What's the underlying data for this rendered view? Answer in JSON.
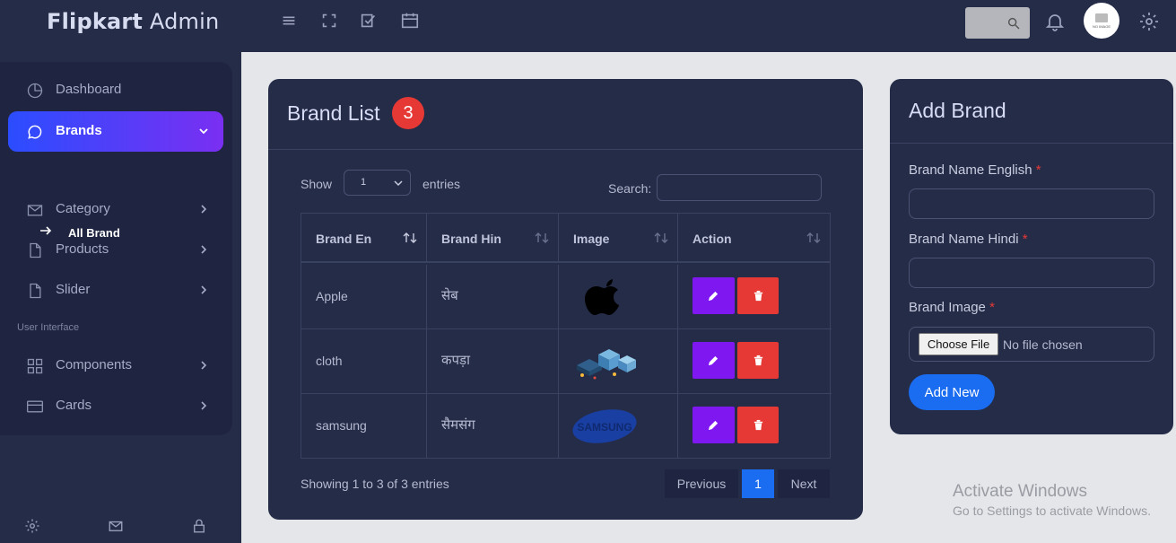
{
  "app": {
    "brand_bold": "Flipkart",
    "brand_rest": " Admin"
  },
  "topbar": {
    "icons": [
      "menu-icon",
      "fullscreen-icon",
      "checklist-icon",
      "calendar-icon"
    ],
    "avatar_text": "NO IMAGE"
  },
  "sidebar": {
    "items": [
      {
        "label": "Dashboard",
        "icon": "pie-chart-icon"
      },
      {
        "label": "Brands",
        "icon": "chat-bubble-icon",
        "active": true
      },
      {
        "label": "Category",
        "icon": "mail-icon"
      },
      {
        "label": "Products",
        "icon": "file-icon"
      },
      {
        "label": "Slider",
        "icon": "file-icon"
      },
      {
        "label": "Components",
        "icon": "grid-icon"
      },
      {
        "label": "Cards",
        "icon": "card-icon"
      }
    ],
    "sub_item": "All Brand",
    "section_title": "User Interface",
    "bottom_icons": [
      "gear-icon",
      "mail-icon",
      "lock-icon"
    ]
  },
  "brand_list": {
    "title": "Brand List",
    "count": "3",
    "show_label": "Show",
    "show_value": "1",
    "entries_label": "entries",
    "search_label": "Search:",
    "columns": [
      "Brand En",
      "Brand Hin",
      "Image",
      "Action"
    ],
    "rows": [
      {
        "en": "Apple",
        "hin": "सेब",
        "image": "apple-logo"
      },
      {
        "en": "cloth",
        "hin": "कपड़ा",
        "image": "isometric-servers"
      },
      {
        "en": "samsung",
        "hin": "सैमसंग",
        "image": "samsung-logo"
      }
    ],
    "samsung_logo_text": "SAMSUNG",
    "showing_text": "Showing 1 to 3 of 3 entries",
    "pagination": {
      "previous": "Previous",
      "page": "1",
      "next": "Next"
    }
  },
  "add_brand": {
    "title": "Add Brand",
    "label_en": "Brand Name English",
    "label_hin": "Brand Name Hindi",
    "label_image": "Brand Image",
    "required_mark": "*",
    "choose_file": "Choose File",
    "no_file": "No file chosen",
    "submit": "Add New"
  },
  "watermark": {
    "line1": "Activate Windows",
    "line2": "Go to Settings to activate Windows."
  },
  "colors": {
    "accent": "#1a6cf0",
    "edit": "#7e17f0",
    "delete": "#e63935",
    "panel": "#252c48"
  }
}
